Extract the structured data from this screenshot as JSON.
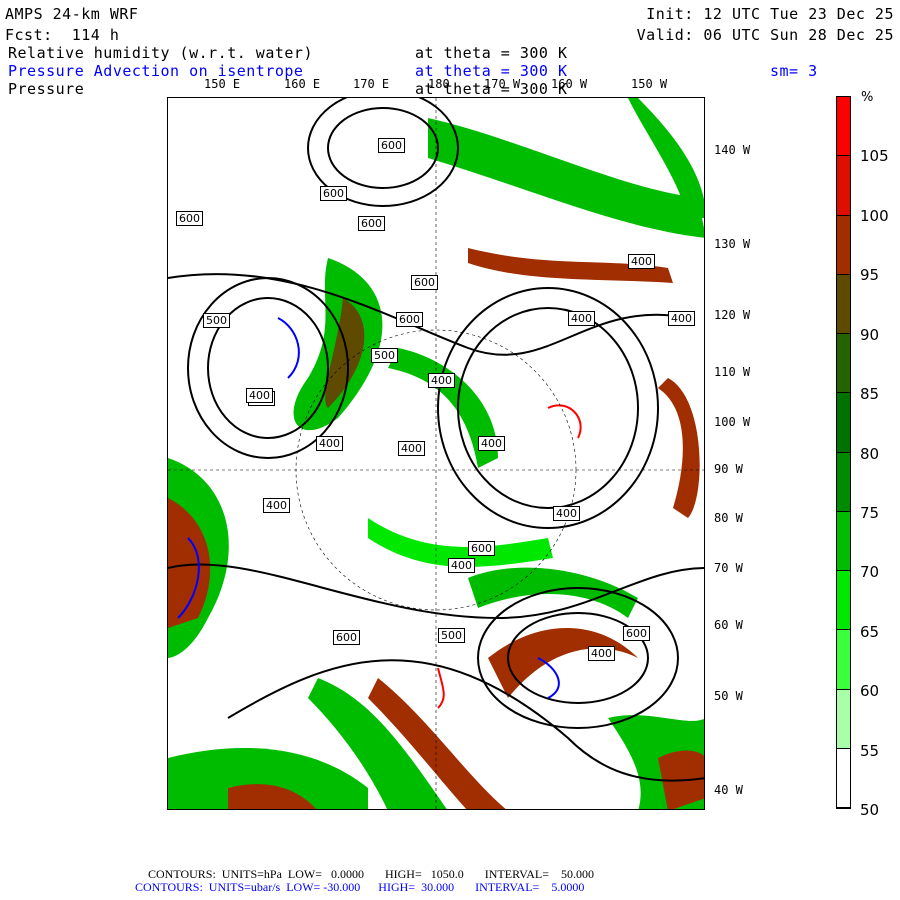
{
  "header": {
    "model": "AMPS 24-km WRF",
    "forecast": "Fcst:  114 h",
    "init": "Init: 12 UTC Tue 23 Dec 25",
    "valid": "Valid: 06 UTC Sun 28 Dec 25"
  },
  "fields": [
    {
      "name": "Relative humidity (w.r.t. water)",
      "level": "at theta = 300 K",
      "color": "#000000"
    },
    {
      "name": "Pressure Advection on isentrope",
      "level": "at theta = 300 K",
      "extra": "sm= 3",
      "color": "#0000ff"
    },
    {
      "name": "Pressure",
      "level": "at theta = 300 K",
      "color": "#000000"
    }
  ],
  "top_longitudes": [
    "150 E",
    "160 E",
    "170 E",
    "180",
    "170 W",
    "160 W",
    "150 W"
  ],
  "right_longitudes": [
    "140 W",
    "130 W",
    "120 W",
    "110 W",
    "100 W",
    "90 W",
    "80 W",
    "70 W",
    "60 W",
    "50 W",
    "40 W"
  ],
  "contour_labels": [
    "600",
    "600",
    "600",
    "600",
    "600",
    "600",
    "500",
    "500",
    "400",
    "400",
    "400",
    "400",
    "400",
    "400",
    "400",
    "400",
    "400",
    "400",
    "400",
    "400",
    "600",
    "600",
    "500",
    "400",
    "600"
  ],
  "colorbar": {
    "unit": "%",
    "labels": [
      "105",
      "100",
      "95",
      "90",
      "85",
      "80",
      "75",
      "70",
      "65",
      "60",
      "55",
      "50"
    ],
    "colors": [
      "#ff0000",
      "#dd0e00",
      "#a02e00",
      "#5e4a00",
      "#236400",
      "#007200",
      "#008a00",
      "#00bc00",
      "#00e800",
      "#3cff3c",
      "#a8ffa8",
      "#ffffff",
      "#ffffff"
    ]
  },
  "footer": {
    "line1": "CONTOURS:  UNITS=hPa  LOW=   0.0000       HIGH=   1050.0       INTERVAL=    50.000",
    "line2": "CONTOURS:  UNITS=ubar/s  LOW= -30.000      HIGH=  30.000       INTERVAL=    5.0000"
  }
}
